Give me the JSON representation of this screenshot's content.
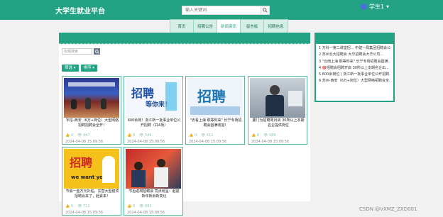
{
  "header": {
    "brand": "大学生就业平台",
    "search_placeholder": "输入关键词",
    "user": "学生1"
  },
  "nav": [
    {
      "label": "首页"
    },
    {
      "label": "招聘公告"
    },
    {
      "label": "新闻资讯"
    },
    {
      "label": "留言板"
    },
    {
      "label": "招聘信息"
    }
  ],
  "filter": {
    "placeholder": "标题搜索",
    "btn_filter": "筛选 ▾",
    "btn_sort": "排序 ▾"
  },
  "sidebar": {
    "items": [
      "1 万科一第二课堂招... 中建一局集团招聘会公...",
      "2 苏州北大招聘会 大华招聘会大华公司...",
      "3 \"云南上海 职等你来\" 长宁专场招聘会圆满...",
      "4 🎯招聘会招聘开启 30所以上本期名企出...",
      "5 600余岗位 | 浙江新一批事业单位公开招聘...",
      "6 苏州-西安（6万+岗位）大型网络招聘会全..."
    ]
  },
  "cards": [
    {
      "title": "宇信-西安（6万+岗位）大型网络招聘招聘会全开！",
      "likes": "0",
      "views": "447",
      "date": "2024-04-08 15:09:56"
    },
    {
      "title": "600余岗！浙江新一批事业单位公开招聘（共4场）",
      "likes": "0",
      "views": "546",
      "date": "2024-04-08 15:09:56"
    },
    {
      "title": "\"去看上海 职等你来\" 长宁专场招聘会圆满收官！",
      "likes": "0",
      "views": "611",
      "date": "2024-04-08 15:09:56"
    },
    {
      "title": "厦门为招聘周月启 30所以上本期名企提供岗位",
      "likes": "0",
      "views": "588",
      "date": "2024-04-08 15:09:56"
    },
    {
      "title": "节假一金万元补贴，东营大型建项招聘会来了，赶紧来！",
      "likes": "0",
      "views": "712",
      "date": "2024-04-08 15:09:56"
    },
    {
      "title": "节后返岗招聘会 亮点纷呈：起航新年新就新变化",
      "likes": "0",
      "views": "693",
      "date": "2024-04-08 15:09:56"
    }
  ],
  "thumb_text": {
    "t2": "招聘",
    "t2b": "等你来！",
    "t3": "招聘",
    "t5": "招聘",
    "t5b": "we want you"
  },
  "watermark": "CSDN @VXMZ_ZXD001",
  "colors": {
    "primary": "#23a383",
    "nav_bg": "#d6efe6"
  }
}
